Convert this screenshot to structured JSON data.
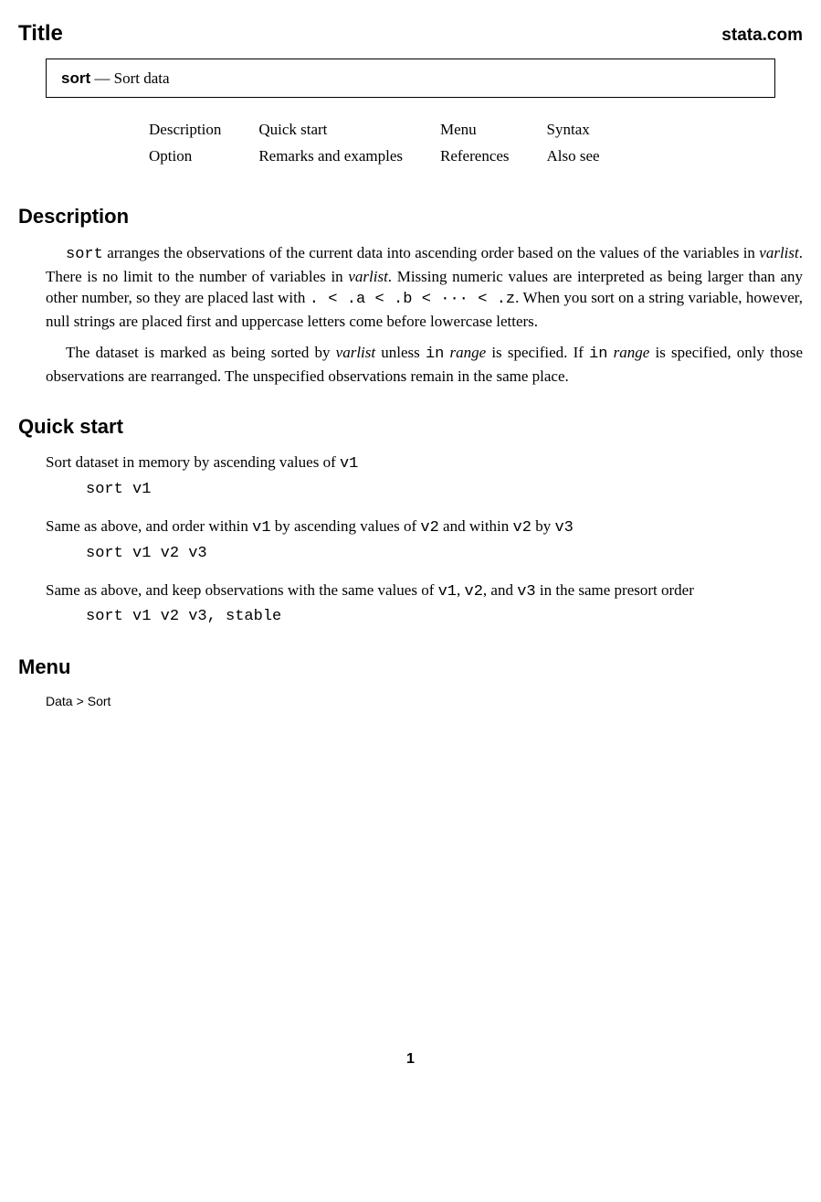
{
  "header": {
    "title": "Title",
    "brand": "stata.com"
  },
  "titlebox": {
    "command": "sort",
    "separator": " — ",
    "short": "Sort data"
  },
  "toc": {
    "row1": [
      "Description",
      "Quick start",
      "Menu",
      "Syntax"
    ],
    "row2": [
      "Option",
      "Remarks and examples",
      "References",
      "Also see"
    ]
  },
  "sections": {
    "description": {
      "heading": "Description",
      "para1_pre": "sort",
      "para1_a": " arranges the observations of the current data into ascending order based on the values of the variables in ",
      "para1_varlist1": "varlist",
      "para1_b": ". There is no limit to the number of variables in ",
      "para1_varlist2": "varlist",
      "para1_c": ". Missing numeric values are interpreted as being larger than any other number, so they are placed last with ",
      "para1_math": ". < .a < .b < ··· < .z",
      "para1_d": ". When you sort on a string variable, however, null strings are placed first and uppercase letters come before lowercase letters.",
      "para2_a": "The dataset is marked as being sorted by ",
      "para2_varlist": "varlist",
      "para2_b": " unless ",
      "para2_in1": "in",
      "para2_c": " ",
      "para2_range1": "range",
      "para2_d": " is specified. If ",
      "para2_in2": "in",
      "para2_e": " ",
      "para2_range2": "range",
      "para2_f": " is specified, only those observations are rearranged. The unspecified observations remain in the same place."
    },
    "quickstart": {
      "heading": "Quick start",
      "items": [
        {
          "desc_a": "Sort dataset in memory by ascending values of ",
          "desc_tt1": "v1",
          "desc_b": "",
          "code": "sort v1"
        },
        {
          "desc_a": "Same as above, and order within ",
          "desc_tt1": "v1",
          "desc_b": " by ascending values of ",
          "desc_tt2": "v2",
          "desc_c": " and within ",
          "desc_tt3": "v2",
          "desc_d": " by ",
          "desc_tt4": "v3",
          "desc_e": "",
          "code": "sort v1 v2 v3"
        },
        {
          "desc_a": "Same as above, and keep observations with the same values of ",
          "desc_tt1": "v1",
          "desc_b": ", ",
          "desc_tt2": "v2",
          "desc_c": ", and ",
          "desc_tt3": "v3",
          "desc_d": " in the same presort order",
          "code": "sort v1 v2 v3, stable"
        }
      ]
    },
    "menu": {
      "heading": "Menu",
      "path": [
        "Data",
        "Sort"
      ]
    }
  },
  "page_number": "1"
}
